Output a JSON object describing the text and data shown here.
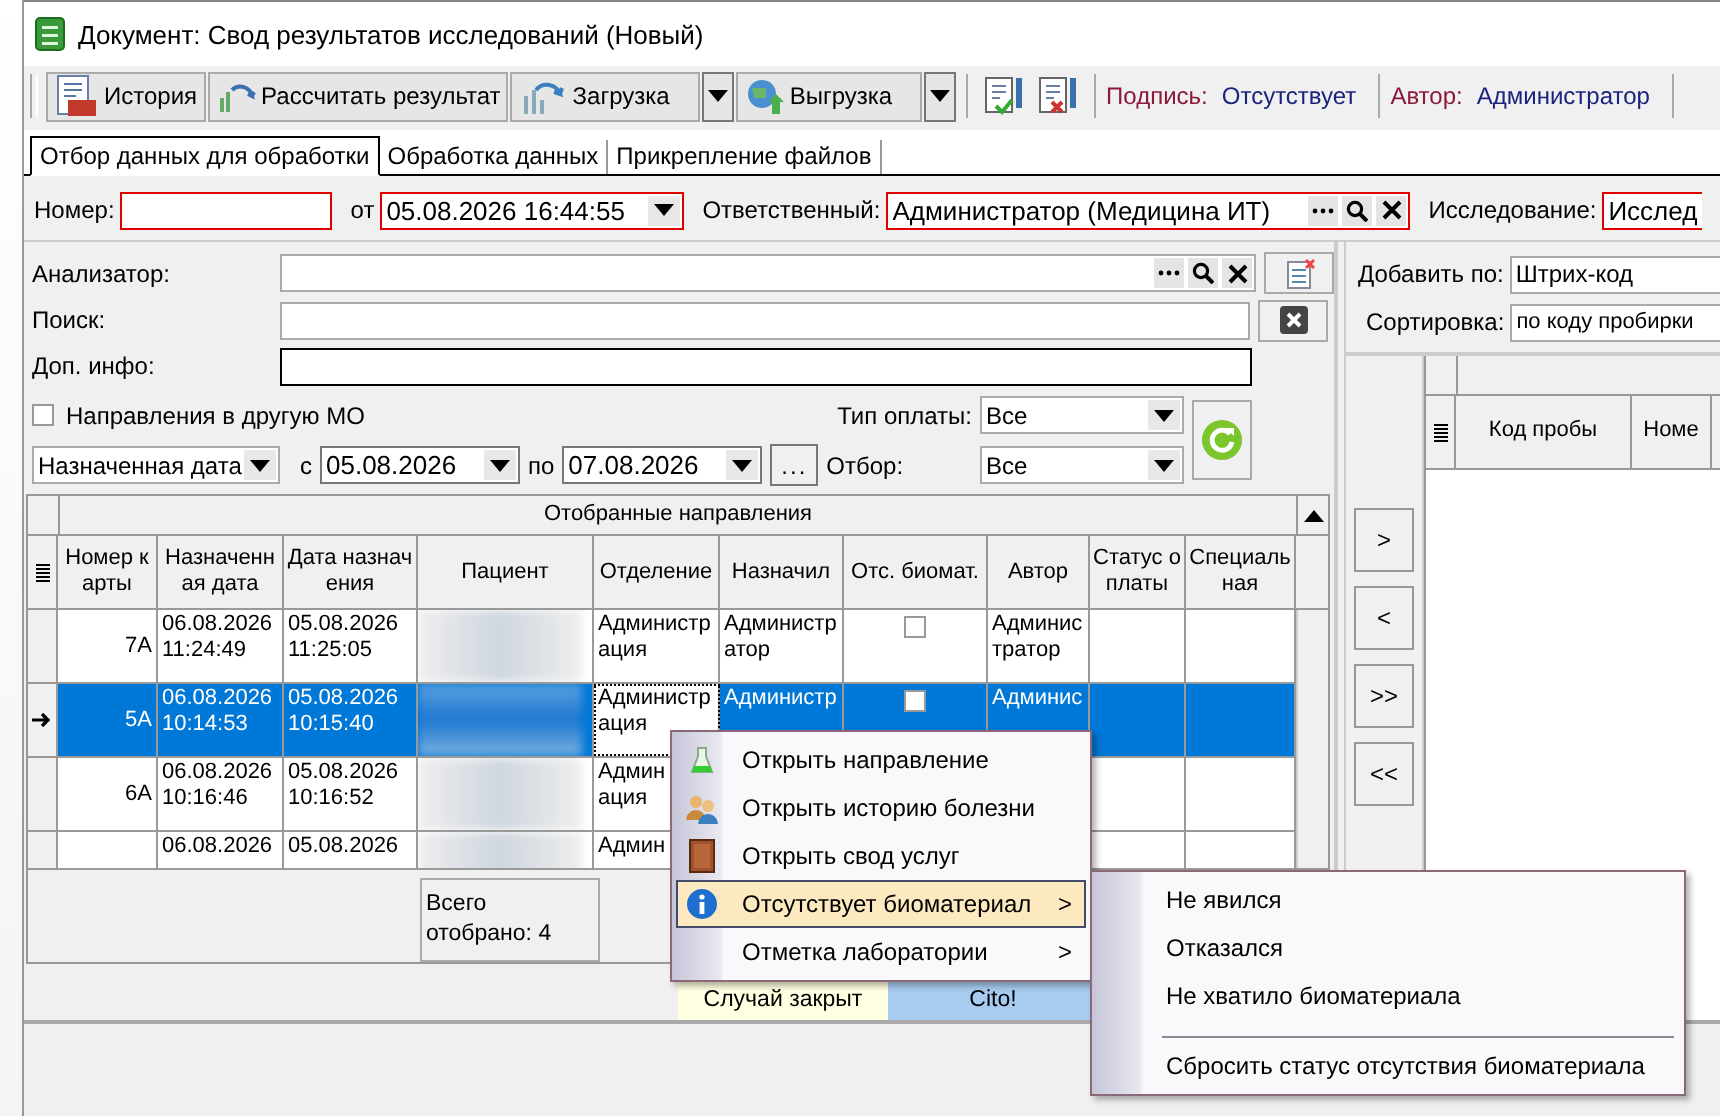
{
  "window": {
    "title": "Документ: Свод результатов исследований (Новый)"
  },
  "toolbar": {
    "buttons": [
      {
        "kind": "log",
        "label": "История",
        "dropdown": false
      },
      {
        "kind": "calc",
        "label": "Рассчитать результат",
        "dropdown": false
      },
      {
        "kind": "load",
        "label": "Загрузка",
        "dropdown": true
      },
      {
        "kind": "unload",
        "label": "Выгрузка",
        "dropdown": true
      },
      {
        "kind": "sign",
        "dropdown": false
      },
      {
        "kind": "unsign",
        "dropdown": false
      }
    ],
    "signature": {
      "label": "Подпись:",
      "value": "Отсутствует"
    },
    "author": {
      "label": "Автор:",
      "value": "Администратор"
    }
  },
  "tabs": [
    {
      "label": "Отбор данных для обработки",
      "selected": true
    },
    {
      "label": "Обработка данных",
      "selected": false
    },
    {
      "label": "Прикрепление файлов",
      "selected": false
    }
  ],
  "header": {
    "number_label": "Номер:",
    "date_label": "от",
    "date_value": "05.08.2026 16:44:55",
    "responsible_label": "Ответственный:",
    "responsible_value": "Администратор (Медицина ИТ)",
    "study_label": "Исследование:",
    "study_value": "Исслед"
  },
  "filters": {
    "analyzer_label": "Анализатор:",
    "search_label": "Поиск:",
    "info_label": "Доп. инфо:",
    "other_mo": {
      "label": "Направления в другую МО",
      "checked": false
    },
    "payment_label": "Тип оплаты:",
    "payment_value": "Все",
    "date_kind": "Назначенная дата",
    "from_label": "с",
    "from_value": "05.08.2026",
    "to_label": "по",
    "to_value": "07.08.2026",
    "more_button": "...",
    "selection_label": "Отбор:",
    "selection_value": "Все"
  },
  "table": {
    "title": "Отобранные направления",
    "columns": [
      "Номер карты",
      "Назначенная дата",
      "Дата назначения",
      "Пациент",
      "Отделение",
      "Назначил",
      "Отс. биомат.",
      "Автор",
      "Статус оплаты",
      "Специальная"
    ],
    "rows": [
      {
        "selected": false,
        "card": "7А",
        "assigned": "06.08.2026 11:24:49",
        "date": "05.08.2026 11:25:05",
        "dept": "Администрация",
        "doctor": "Администратор",
        "biomat_missing": false,
        "author": "Администратор"
      },
      {
        "selected": true,
        "card": "5А",
        "assigned": "06.08.2026 10:14:53",
        "date": "05.08.2026 10:15:40",
        "dept": "Администрация",
        "doctor": "Администр",
        "biomat_missing": false,
        "author": "Админис"
      },
      {
        "selected": false,
        "card": "6А",
        "assigned": "06.08.2026 10:16:46",
        "date": "05.08.2026 10:16:52",
        "dept": "Админ\nация"
      },
      {
        "selected": false,
        "assigned": "06.08.2026",
        "date": "05.08.2026",
        "dept": "Админ"
      }
    ],
    "total": "Всего отобрано: 4"
  },
  "legend": [
    {
      "label": "Случай закрыт",
      "color": "#ffffe1"
    },
    {
      "label": "Cito!",
      "color": "#a8cbf0"
    }
  ],
  "right": {
    "add_label": "Добавить по:",
    "add_value": "Штрих-код",
    "sort_label": "Сортировка:",
    "sort_value": "по коду пробирки",
    "move_buttons": [
      ">",
      "<",
      ">>",
      "<<"
    ],
    "columns": [
      "Код пробы",
      "Номе"
    ]
  },
  "context_menu": {
    "items": [
      {
        "label": "Открыть направление",
        "submenu": false,
        "selected": false
      },
      {
        "label": "Открыть историю болезни",
        "submenu": false,
        "selected": false
      },
      {
        "label": "Открыть свод услуг",
        "submenu": false,
        "selected": false
      },
      {
        "label": "Отсутствует биоматериал",
        "submenu": true,
        "selected": true
      },
      {
        "label": "Отметка лаборатории",
        "submenu": true,
        "selected": false
      }
    ],
    "submenu_arrow": ">",
    "submenu": [
      {
        "label": "Не явился",
        "separator_before": false
      },
      {
        "label": "Отказался",
        "separator_before": false
      },
      {
        "label": "Не хватило биоматериала",
        "separator_before": false
      },
      {
        "label": "Сбросить статус отсутствия биоматериала",
        "separator_before": true
      }
    ]
  }
}
